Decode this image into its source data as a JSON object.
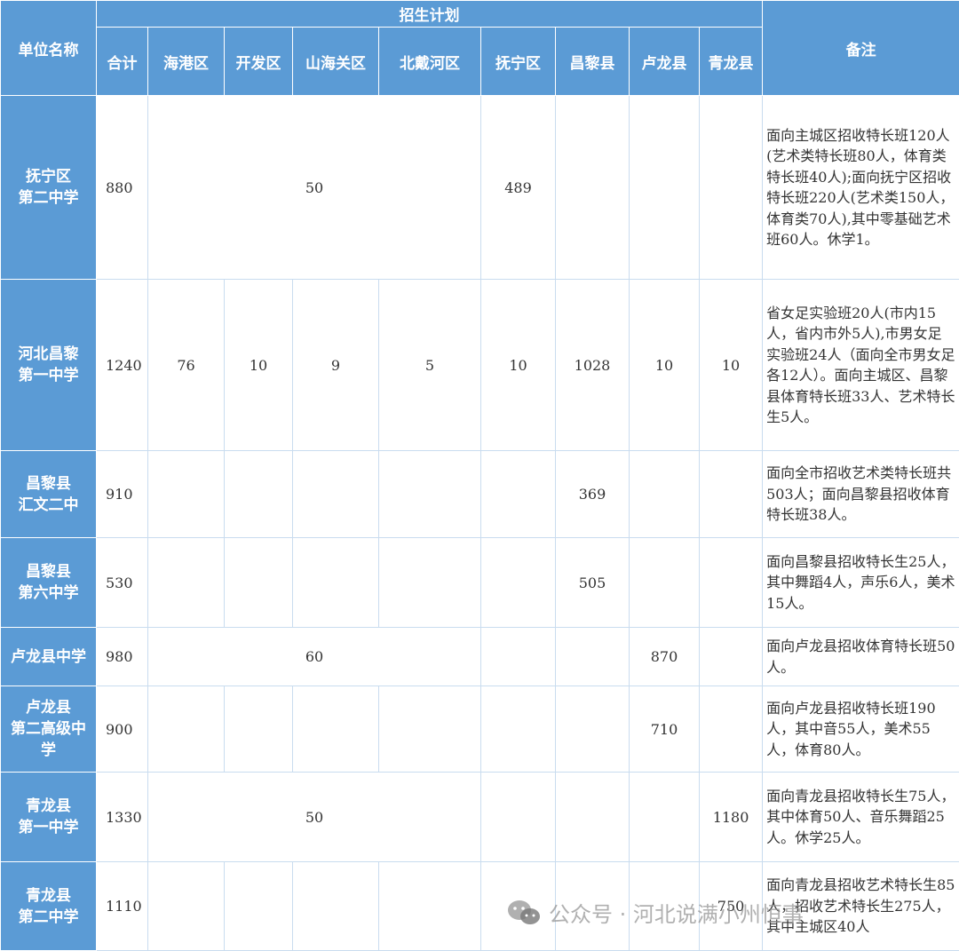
{
  "header": {
    "unit_name": "单位名称",
    "plan_title": "招生计划",
    "total": "合计",
    "remarks": "备注",
    "districts": [
      "海港区",
      "开发区",
      "山海关区",
      "北戴河区",
      "抚宁区",
      "昌黎县",
      "卢龙县",
      "青龙县"
    ]
  },
  "rows": [
    {
      "name": "抚宁区\n第二中学",
      "total": "880",
      "shared": "50",
      "local": "489",
      "note": "面向主城区招收特长班120人(艺术类特长班80人，体育类特长班40人);面向抚宁区招收特长班220人(艺术类150人，体育类70人),其中零基础艺术班60人。休学1。"
    },
    {
      "name": "河北昌黎\n第一中学",
      "total": "1240",
      "values": [
        "76",
        "10",
        "9",
        "5",
        "10",
        "1028",
        "10",
        "10"
      ],
      "note": "省女足实验班20人(市内15人，省内市外5人),市男女足实验班24人（面向全市男女足各12人）。面向主城区、昌黎县体育特长班33人、艺术特长生5人。"
    },
    {
      "name": "昌黎县\n汇文二中",
      "total": "910",
      "local": "369",
      "note": "面向全市招收艺术类特长班共503人；面向昌黎县招收体育特长班38人。"
    },
    {
      "name": "昌黎县\n第六中学",
      "total": "530",
      "local": "505",
      "note": "面向昌黎县招收特长生25人，其中舞蹈4人，声乐6人，美术15人。"
    },
    {
      "name": "卢龙县中学",
      "total": "980",
      "shared": "60",
      "local": "870",
      "note": "面向卢龙县招收体育特长班50人。"
    },
    {
      "name": "卢龙县\n第二高级中\n学",
      "total": "900",
      "local": "710",
      "note": "面向卢龙县招收特长班190人，其中音55人，美术55人，体育80人。"
    },
    {
      "name": "青龙县\n第一中学",
      "total": "1330",
      "shared": "50",
      "local": "1180",
      "note": "面向青龙县招收特长生75人，其中体育50人、音乐舞蹈25人。休学25人。"
    },
    {
      "name": "青龙县\n第二中学",
      "total": "1110",
      "local": "750",
      "note": "面向青龙县招收艺术特长生85人，招收艺术特长生275人，其中主城区40人"
    }
  ],
  "watermark": {
    "text": "公众号 · 河北说满小州恒事",
    "icon": "wechat-icon"
  }
}
